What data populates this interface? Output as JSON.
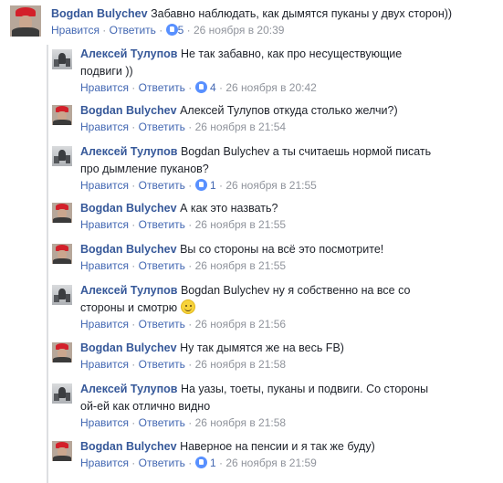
{
  "comments": [
    {
      "author": "Bogdan Bulychev",
      "text": "Забавно наблюдать, как дымятся пуканы у двух сторон))",
      "lines": [],
      "like": "Нравится",
      "reply": "Ответить",
      "likes": "5",
      "date": "26 ноября в 20:39"
    },
    {
      "author": "Алексей Тулупов",
      "text": "Не так забавно, как про несуществующие",
      "text2": "подвиги ))",
      "like": "Нравится",
      "reply": "Ответить",
      "likes": "4",
      "date": "26 ноября в 20:42"
    },
    {
      "author": "Bogdan Bulychev",
      "text": "Алексей Тулупов откуда столько желчи?)",
      "like": "Нравится",
      "reply": "Ответить",
      "date": "26 ноября в 21:54"
    },
    {
      "author": "Алексей Тулупов",
      "text": "Bogdan Bulychev а ты считаешь нормой писать",
      "text2": "про дымление пуканов?",
      "like": "Нравится",
      "reply": "Ответить",
      "likes": "1",
      "date": "26 ноября в 21:55"
    },
    {
      "author": "Bogdan Bulychev",
      "text": "А как это назвать?",
      "like": "Нравится",
      "reply": "Ответить",
      "date": "26 ноября в 21:55"
    },
    {
      "author": "Bogdan Bulychev",
      "text": "Вы со стороны на всё это посмотрите!",
      "like": "Нравится",
      "reply": "Ответить",
      "date": "26 ноября в 21:55"
    },
    {
      "author": "Алексей Тулупов",
      "text": "Bogdan Bulychev ну я собственно на все со",
      "text2": "стороны и смотрю",
      "like": "Нравится",
      "reply": "Ответить",
      "date": "26 ноября в 21:56"
    },
    {
      "author": "Bogdan Bulychev",
      "text": "Ну так дымятся же на весь FB)",
      "like": "Нравится",
      "reply": "Ответить",
      "date": "26 ноября в 21:58"
    },
    {
      "author": "Алексей Тулупов",
      "text": "На уазы, тоеты, пуканы и подвиги. Со стороны",
      "text2": "ой-ей как отлично видно",
      "like": "Нравится",
      "reply": "Ответить",
      "date": "26 ноября в 21:58"
    },
    {
      "author": "Bogdan Bulychev",
      "text": "Наверное на пенсии и я так же буду)",
      "like": "Нравится",
      "reply": "Ответить",
      "likes": "1",
      "date": "26 ноября в 21:59"
    }
  ],
  "separator": "·",
  "icons": {
    "like": "like-thumb-icon",
    "emoji": "smile-emoji-icon"
  },
  "colors": {
    "author": "#365899",
    "link": "#4267b2",
    "meta": "#90949c",
    "like_badge": "#5890ff"
  }
}
